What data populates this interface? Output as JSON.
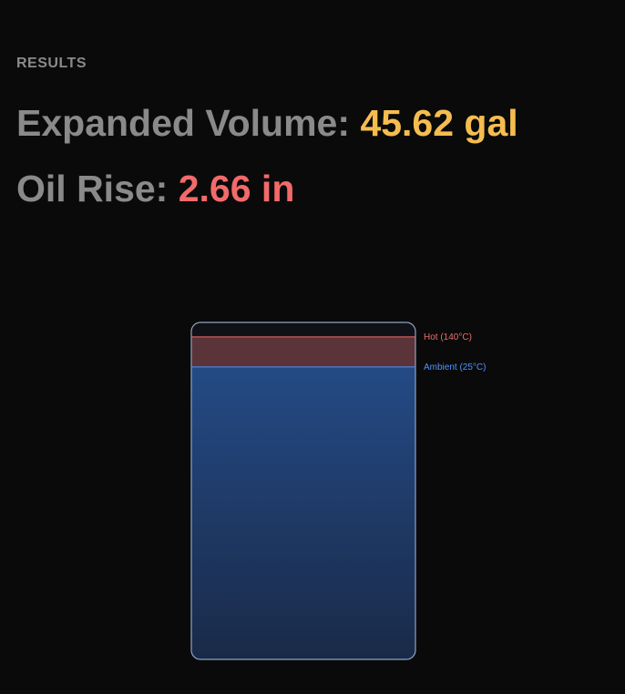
{
  "results": {
    "heading": "RESULTS",
    "expanded_volume_label": "Expanded Volume:",
    "expanded_volume_value": "45.62 gal",
    "oil_rise_label": "Oil Rise:",
    "oil_rise_value": "2.66 in"
  },
  "tank": {
    "hot_label": "Hot (140°C)",
    "ambient_label": "Ambient (25°C)",
    "hot_level_fraction": 0.957,
    "ambient_level_fraction": 0.868
  },
  "colors": {
    "background": "#0a0a0a",
    "label_gray": "#8a8a8a",
    "volume_accent": "#f5bd4f",
    "rise_accent": "#f26a6a",
    "tank_border": "#8fa3c4",
    "oil_top": "#244a85",
    "oil_bottom": "#192a48",
    "expansion_band": "#5a3438",
    "hot_marker": "#f06a6a",
    "ambient_marker": "#4d94ff"
  }
}
